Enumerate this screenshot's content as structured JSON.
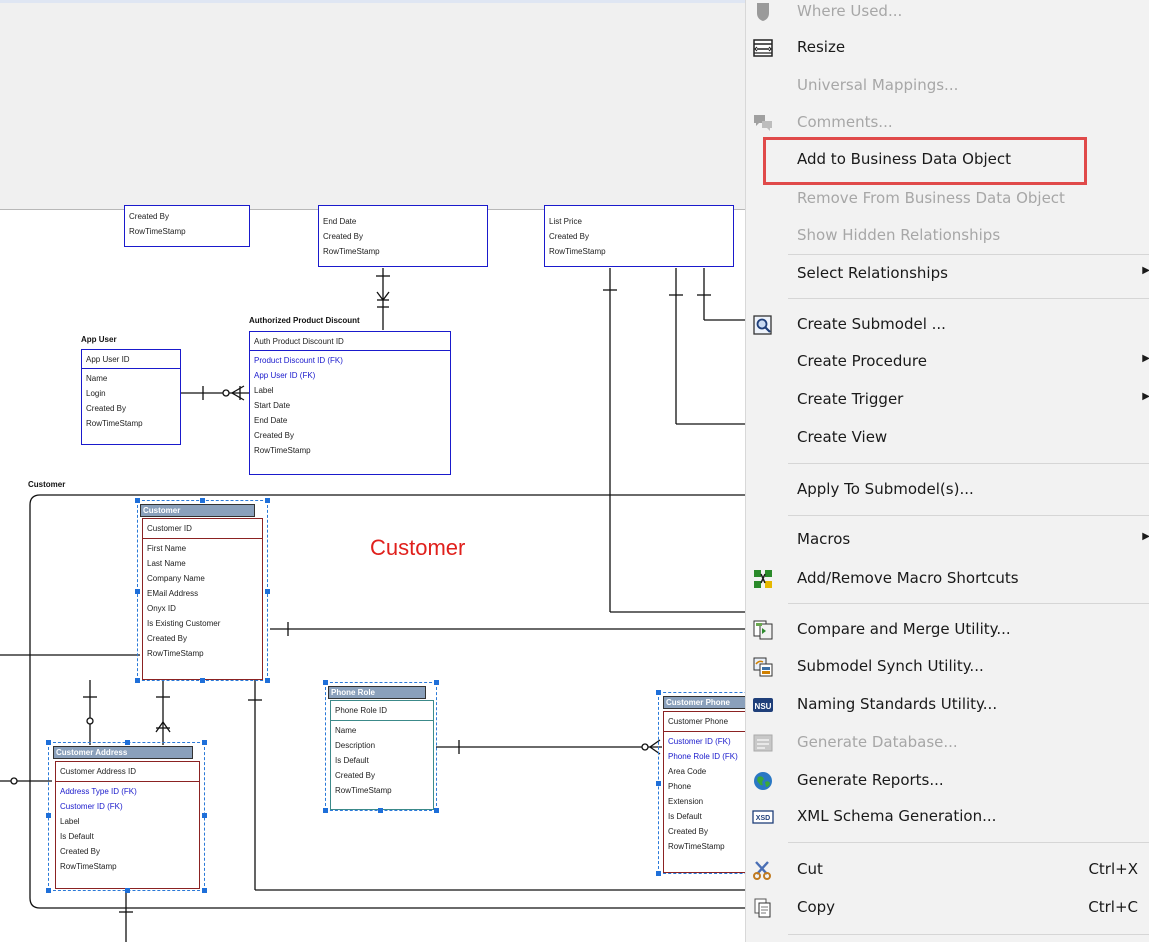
{
  "canvas": {
    "group_label": "Customer",
    "big_label": "Customer",
    "entities": {
      "top_left": {
        "attrs": [
          "Created By",
          "RowTimeStamp"
        ]
      },
      "top_mid": {
        "attrs": [
          "End Date",
          "Created By",
          "RowTimeStamp"
        ]
      },
      "top_right": {
        "attrs": [
          "List Price",
          "Created By",
          "RowTimeStamp"
        ]
      },
      "app_user": {
        "title": "App User",
        "key": "App User ID",
        "attrs": [
          "Name",
          "Login",
          "Created By",
          "RowTimeStamp"
        ]
      },
      "auth_discount": {
        "title": "Authorized Product Discount",
        "key": "Auth Product Discount ID",
        "fk": [
          "Product Discount ID (FK)",
          "App User ID (FK)"
        ],
        "attrs": [
          "Label",
          "Start Date",
          "End Date",
          "Created By",
          "RowTimeStamp"
        ]
      },
      "customer": {
        "title": "Customer",
        "key": "Customer ID",
        "attrs": [
          "First Name",
          "Last Name",
          "Company Name",
          "EMail Address",
          "Onyx ID",
          "Is Existing Customer",
          "Created By",
          "RowTimeStamp"
        ]
      },
      "phone_role": {
        "title": "Phone Role",
        "key": "Phone Role ID",
        "attrs": [
          "Name",
          "Description",
          "Is Default",
          "Created By",
          "RowTimeStamp"
        ]
      },
      "customer_address": {
        "title": "Customer Address",
        "key": "Customer Address ID",
        "fk": [
          "Address Type ID (FK)",
          "Customer ID (FK)"
        ],
        "attrs": [
          "Label",
          "Is Default",
          "Created By",
          "RowTimeStamp"
        ]
      },
      "customer_phone": {
        "title": "Customer Phone",
        "key": "Customer Phone",
        "fk": [
          "Customer ID (FK)",
          "Phone Role ID (FK)"
        ],
        "attrs": [
          "Area Code",
          "Phone",
          "Extension",
          "Is Default",
          "Created By",
          "RowTimeStamp"
        ]
      }
    }
  },
  "menu": {
    "items": [
      {
        "label": "Where Used...",
        "disabled": true,
        "icon": "where-used-icon"
      },
      {
        "label": "Resize",
        "disabled": false,
        "icon": "resize-icon"
      },
      {
        "label": "Universal Mappings...",
        "disabled": true,
        "icon": ""
      },
      {
        "label": "Comments...",
        "disabled": true,
        "icon": "comments-icon"
      },
      {
        "label": "Add to Business Data Object",
        "disabled": false,
        "icon": "",
        "highlighted": true
      },
      {
        "label": "Remove From Business Data Object",
        "disabled": true,
        "icon": ""
      },
      {
        "label": "Show Hidden Relationships",
        "disabled": true,
        "icon": ""
      },
      {
        "label": "Select Relationships",
        "disabled": false,
        "icon": "",
        "submenu": true
      },
      {
        "label": "Create Submodel ...",
        "disabled": false,
        "icon": "create-submodel-icon"
      },
      {
        "label": "Create Procedure",
        "disabled": false,
        "icon": "",
        "submenu": true
      },
      {
        "label": "Create Trigger",
        "disabled": false,
        "icon": "",
        "submenu": true
      },
      {
        "label": "Create View",
        "disabled": false,
        "icon": ""
      },
      {
        "label": "Apply To Submodel(s)...",
        "disabled": false,
        "icon": ""
      },
      {
        "label": "Macros",
        "disabled": false,
        "icon": "",
        "submenu": true
      },
      {
        "label": "Add/Remove Macro Shortcuts",
        "disabled": false,
        "icon": "macro-shortcuts-icon"
      },
      {
        "label": "Compare and Merge Utility...",
        "disabled": false,
        "icon": "compare-merge-icon"
      },
      {
        "label": "Submodel Synch Utility...",
        "disabled": false,
        "icon": "submodel-synch-icon"
      },
      {
        "label": "Naming Standards Utility...",
        "disabled": false,
        "icon": "naming-standards-icon",
        "icon_text": "NSU"
      },
      {
        "label": "Generate Database...",
        "disabled": true,
        "icon": "generate-database-icon"
      },
      {
        "label": "Generate Reports...",
        "disabled": false,
        "icon": "generate-reports-icon"
      },
      {
        "label": "XML Schema Generation...",
        "disabled": false,
        "icon": "xml-schema-icon",
        "icon_text": "XSD"
      },
      {
        "label": "Cut",
        "shortcut": "Ctrl+X",
        "disabled": false,
        "icon": "scissors-icon"
      },
      {
        "label": "Copy",
        "shortcut": "Ctrl+C",
        "disabled": false,
        "icon": "copy-icon"
      }
    ]
  },
  "colors": {
    "highlight_border": "#e04a4a",
    "entity_border": "#1a1acc",
    "selection": "#1e6fd9",
    "big_label": "#e0201c"
  }
}
